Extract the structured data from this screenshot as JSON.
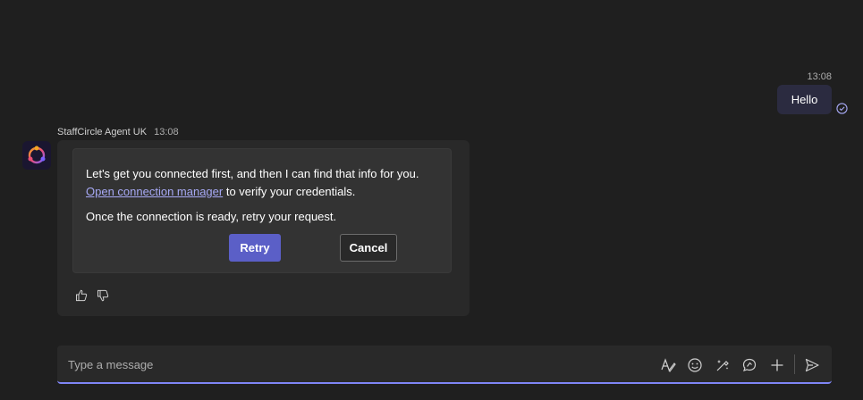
{
  "outgoing": {
    "time": "13:08",
    "text": "Hello"
  },
  "agent": {
    "name": "StaffCircle Agent UK",
    "time": "13:08",
    "line1": "Let's get you connected first, and then I can find that info for you.",
    "link": "Open connection manager",
    "line1_suffix": " to verify your credentials.",
    "line2": "Once the connection is ready, retry your request.",
    "retry_label": "Retry",
    "cancel_label": "Cancel"
  },
  "compose": {
    "placeholder": "Type a message"
  },
  "colors": {
    "background": "#1f1f1f",
    "accent": "#5b5fc7",
    "link": "#a7a9f5",
    "outgoing_bubble": "#2b2b40"
  }
}
